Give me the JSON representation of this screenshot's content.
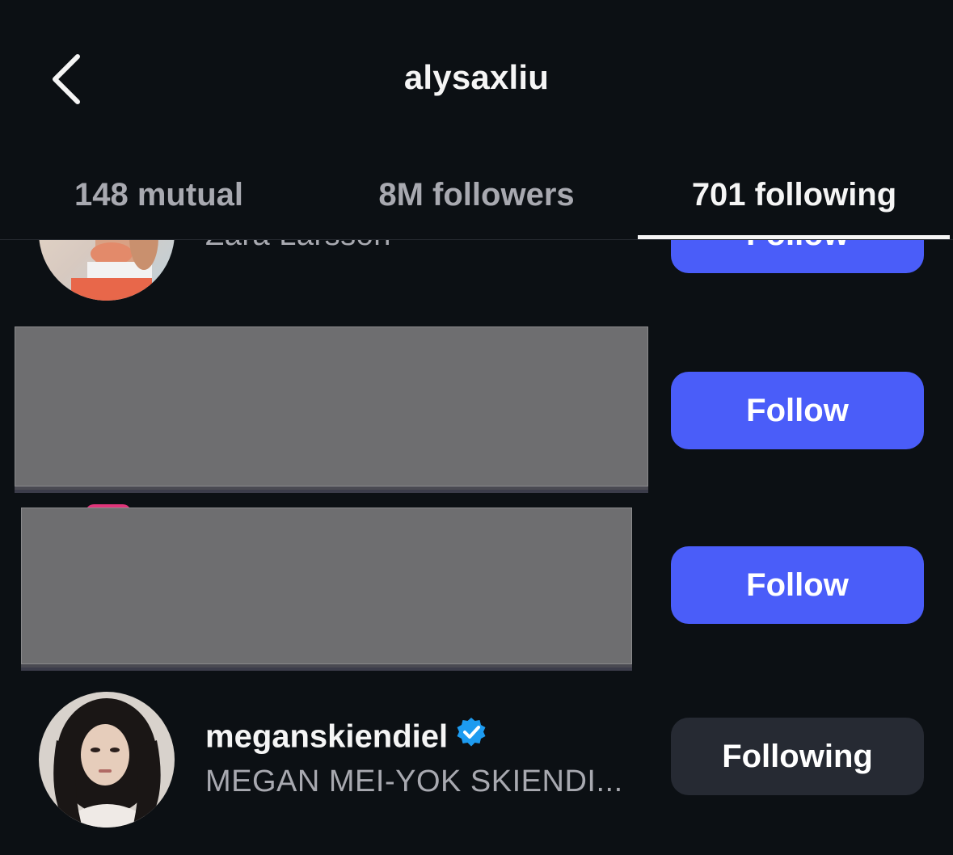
{
  "header": {
    "title": "alysaxliu"
  },
  "tabs": [
    {
      "label": "148 mutual",
      "active": false
    },
    {
      "label": "8M followers",
      "active": false
    },
    {
      "label": "701 following",
      "active": true
    }
  ],
  "rows": [
    {
      "fullname": "Zara Larsson",
      "button_label": "Follow"
    },
    {
      "button_label": "Follow"
    },
    {
      "button_label": "Follow"
    },
    {
      "username": "meganskiendiel",
      "verified": true,
      "fullname": "MEGAN MEI-YOK SKIENDI...",
      "button_label": "Following"
    }
  ],
  "colors": {
    "background": "#0c1014",
    "follow_button": "#4a5df9",
    "following_button": "#262a33",
    "verified_badge": "#1d9bf0",
    "secondary_text": "#a8a9b0"
  },
  "icons": {
    "back": "chevron-left-icon",
    "verified": "verified-badge-icon"
  }
}
